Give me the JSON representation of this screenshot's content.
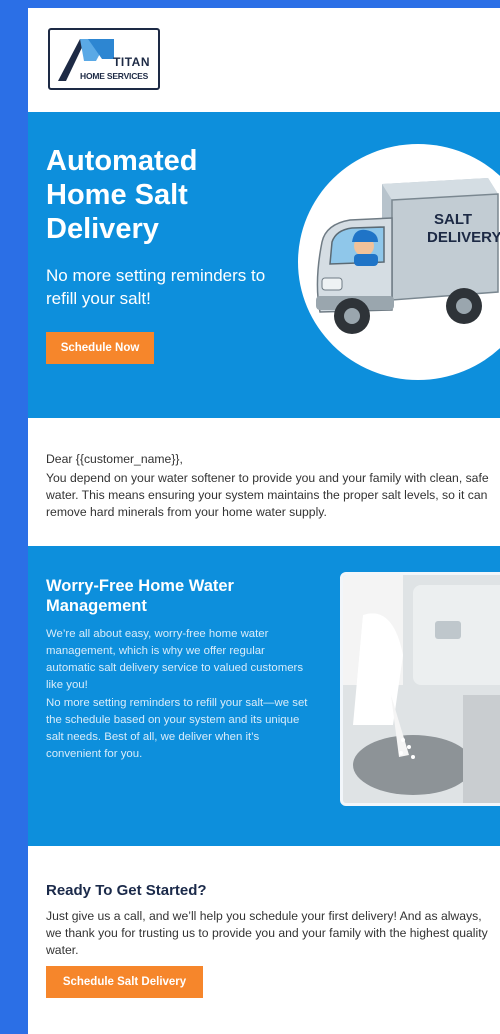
{
  "logo": {
    "brand": "TITAN",
    "sub": "HOME SERVICES"
  },
  "hero": {
    "title": "Automated Home Salt Delivery",
    "tagline": "No more setting reminders to refill your salt!",
    "cta_label": "Schedule Now",
    "truck_sign": [
      "SALT",
      "DELIVERY"
    ]
  },
  "letter": {
    "greeting": "Dear {{customer_name}},",
    "body": "You depend on your water softener to provide you and your family with clean, safe water. This means ensuring your system maintains the proper salt levels, so it can remove hard minerals from your home water supply."
  },
  "worry": {
    "title": "Worry-Free Home Water Management",
    "p1": "We’re all about easy, worry-free home water management, which is why we offer regular automatic salt delivery service to valued customers like you!",
    "p2": "No more setting reminders to refill your salt—we set the schedule based on your system and its unique salt needs. Best of all, we deliver when it’s convenient for you."
  },
  "cta": {
    "title": "Ready To Get Started?",
    "body": "Just give us a call, and we’ll help you schedule your first delivery! And as always, we thank you for trusting us to provide you and your family with the highest quality water.",
    "button": "Schedule Salt Delivery"
  },
  "colors": {
    "brand_blue": "#0d8fdc",
    "accent_orange": "#f6862b",
    "frame_blue": "#2b6fe6"
  }
}
